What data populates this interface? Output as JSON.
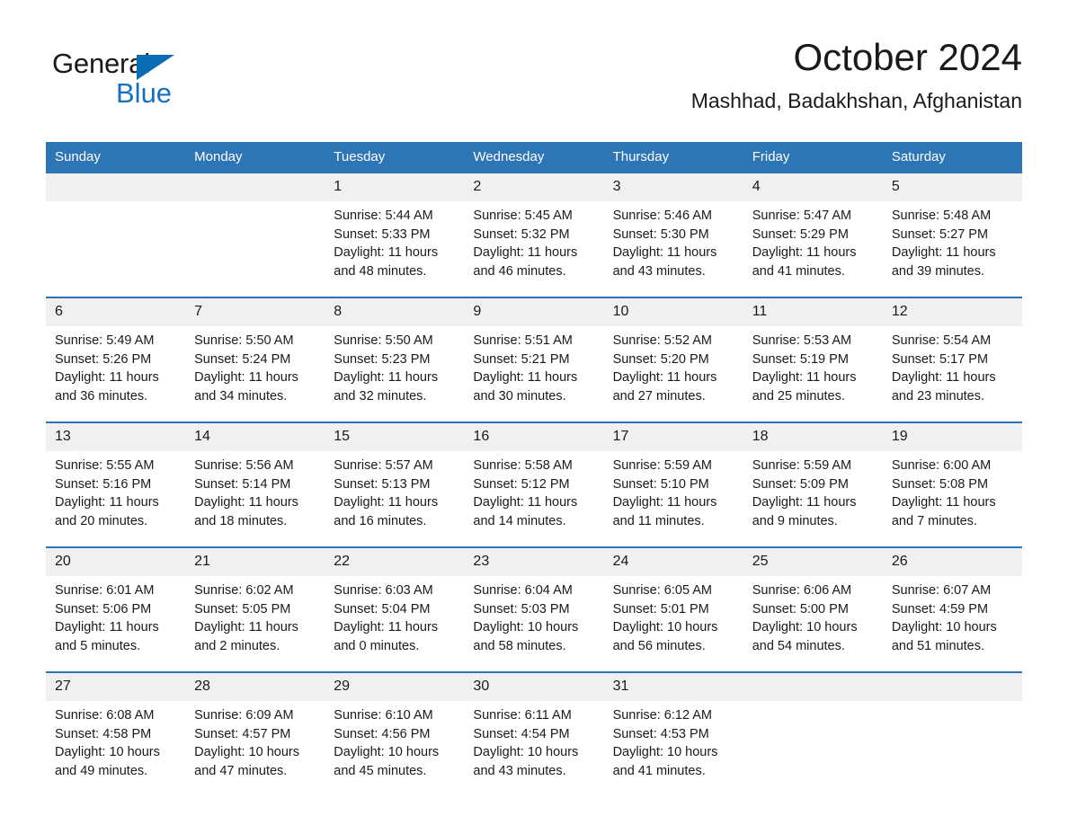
{
  "brand": {
    "name_part1": "General",
    "name_part2": "Blue",
    "accent_color": "#1670c2",
    "triangle_color": "#0a6cb5"
  },
  "header": {
    "title": "October 2024",
    "subtitle": "Mashhad, Badakhshan, Afghanistan"
  },
  "theme": {
    "header_bg": "#2e75b6",
    "daynum_bg": "#f0f0f0",
    "text_color": "#1a1a1a"
  },
  "weekdays": [
    "Sunday",
    "Monday",
    "Tuesday",
    "Wednesday",
    "Thursday",
    "Friday",
    "Saturday"
  ],
  "labels": {
    "sunrise_prefix": "Sunrise:",
    "sunset_prefix": "Sunset:",
    "daylight_prefix": "Daylight:"
  },
  "weeks": [
    [
      {
        "day": "",
        "sunrise": "",
        "sunset": "",
        "daylight": ""
      },
      {
        "day": "",
        "sunrise": "",
        "sunset": "",
        "daylight": ""
      },
      {
        "day": "1",
        "sunrise": "Sunrise: 5:44 AM",
        "sunset": "Sunset: 5:33 PM",
        "daylight": "Daylight: 11 hours and 48 minutes."
      },
      {
        "day": "2",
        "sunrise": "Sunrise: 5:45 AM",
        "sunset": "Sunset: 5:32 PM",
        "daylight": "Daylight: 11 hours and 46 minutes."
      },
      {
        "day": "3",
        "sunrise": "Sunrise: 5:46 AM",
        "sunset": "Sunset: 5:30 PM",
        "daylight": "Daylight: 11 hours and 43 minutes."
      },
      {
        "day": "4",
        "sunrise": "Sunrise: 5:47 AM",
        "sunset": "Sunset: 5:29 PM",
        "daylight": "Daylight: 11 hours and 41 minutes."
      },
      {
        "day": "5",
        "sunrise": "Sunrise: 5:48 AM",
        "sunset": "Sunset: 5:27 PM",
        "daylight": "Daylight: 11 hours and 39 minutes."
      }
    ],
    [
      {
        "day": "6",
        "sunrise": "Sunrise: 5:49 AM",
        "sunset": "Sunset: 5:26 PM",
        "daylight": "Daylight: 11 hours and 36 minutes."
      },
      {
        "day": "7",
        "sunrise": "Sunrise: 5:50 AM",
        "sunset": "Sunset: 5:24 PM",
        "daylight": "Daylight: 11 hours and 34 minutes."
      },
      {
        "day": "8",
        "sunrise": "Sunrise: 5:50 AM",
        "sunset": "Sunset: 5:23 PM",
        "daylight": "Daylight: 11 hours and 32 minutes."
      },
      {
        "day": "9",
        "sunrise": "Sunrise: 5:51 AM",
        "sunset": "Sunset: 5:21 PM",
        "daylight": "Daylight: 11 hours and 30 minutes."
      },
      {
        "day": "10",
        "sunrise": "Sunrise: 5:52 AM",
        "sunset": "Sunset: 5:20 PM",
        "daylight": "Daylight: 11 hours and 27 minutes."
      },
      {
        "day": "11",
        "sunrise": "Sunrise: 5:53 AM",
        "sunset": "Sunset: 5:19 PM",
        "daylight": "Daylight: 11 hours and 25 minutes."
      },
      {
        "day": "12",
        "sunrise": "Sunrise: 5:54 AM",
        "sunset": "Sunset: 5:17 PM",
        "daylight": "Daylight: 11 hours and 23 minutes."
      }
    ],
    [
      {
        "day": "13",
        "sunrise": "Sunrise: 5:55 AM",
        "sunset": "Sunset: 5:16 PM",
        "daylight": "Daylight: 11 hours and 20 minutes."
      },
      {
        "day": "14",
        "sunrise": "Sunrise: 5:56 AM",
        "sunset": "Sunset: 5:14 PM",
        "daylight": "Daylight: 11 hours and 18 minutes."
      },
      {
        "day": "15",
        "sunrise": "Sunrise: 5:57 AM",
        "sunset": "Sunset: 5:13 PM",
        "daylight": "Daylight: 11 hours and 16 minutes."
      },
      {
        "day": "16",
        "sunrise": "Sunrise: 5:58 AM",
        "sunset": "Sunset: 5:12 PM",
        "daylight": "Daylight: 11 hours and 14 minutes."
      },
      {
        "day": "17",
        "sunrise": "Sunrise: 5:59 AM",
        "sunset": "Sunset: 5:10 PM",
        "daylight": "Daylight: 11 hours and 11 minutes."
      },
      {
        "day": "18",
        "sunrise": "Sunrise: 5:59 AM",
        "sunset": "Sunset: 5:09 PM",
        "daylight": "Daylight: 11 hours and 9 minutes."
      },
      {
        "day": "19",
        "sunrise": "Sunrise: 6:00 AM",
        "sunset": "Sunset: 5:08 PM",
        "daylight": "Daylight: 11 hours and 7 minutes."
      }
    ],
    [
      {
        "day": "20",
        "sunrise": "Sunrise: 6:01 AM",
        "sunset": "Sunset: 5:06 PM",
        "daylight": "Daylight: 11 hours and 5 minutes."
      },
      {
        "day": "21",
        "sunrise": "Sunrise: 6:02 AM",
        "sunset": "Sunset: 5:05 PM",
        "daylight": "Daylight: 11 hours and 2 minutes."
      },
      {
        "day": "22",
        "sunrise": "Sunrise: 6:03 AM",
        "sunset": "Sunset: 5:04 PM",
        "daylight": "Daylight: 11 hours and 0 minutes."
      },
      {
        "day": "23",
        "sunrise": "Sunrise: 6:04 AM",
        "sunset": "Sunset: 5:03 PM",
        "daylight": "Daylight: 10 hours and 58 minutes."
      },
      {
        "day": "24",
        "sunrise": "Sunrise: 6:05 AM",
        "sunset": "Sunset: 5:01 PM",
        "daylight": "Daylight: 10 hours and 56 minutes."
      },
      {
        "day": "25",
        "sunrise": "Sunrise: 6:06 AM",
        "sunset": "Sunset: 5:00 PM",
        "daylight": "Daylight: 10 hours and 54 minutes."
      },
      {
        "day": "26",
        "sunrise": "Sunrise: 6:07 AM",
        "sunset": "Sunset: 4:59 PM",
        "daylight": "Daylight: 10 hours and 51 minutes."
      }
    ],
    [
      {
        "day": "27",
        "sunrise": "Sunrise: 6:08 AM",
        "sunset": "Sunset: 4:58 PM",
        "daylight": "Daylight: 10 hours and 49 minutes."
      },
      {
        "day": "28",
        "sunrise": "Sunrise: 6:09 AM",
        "sunset": "Sunset: 4:57 PM",
        "daylight": "Daylight: 10 hours and 47 minutes."
      },
      {
        "day": "29",
        "sunrise": "Sunrise: 6:10 AM",
        "sunset": "Sunset: 4:56 PM",
        "daylight": "Daylight: 10 hours and 45 minutes."
      },
      {
        "day": "30",
        "sunrise": "Sunrise: 6:11 AM",
        "sunset": "Sunset: 4:54 PM",
        "daylight": "Daylight: 10 hours and 43 minutes."
      },
      {
        "day": "31",
        "sunrise": "Sunrise: 6:12 AM",
        "sunset": "Sunset: 4:53 PM",
        "daylight": "Daylight: 10 hours and 41 minutes."
      },
      {
        "day": "",
        "sunrise": "",
        "sunset": "",
        "daylight": ""
      },
      {
        "day": "",
        "sunrise": "",
        "sunset": "",
        "daylight": ""
      }
    ]
  ]
}
